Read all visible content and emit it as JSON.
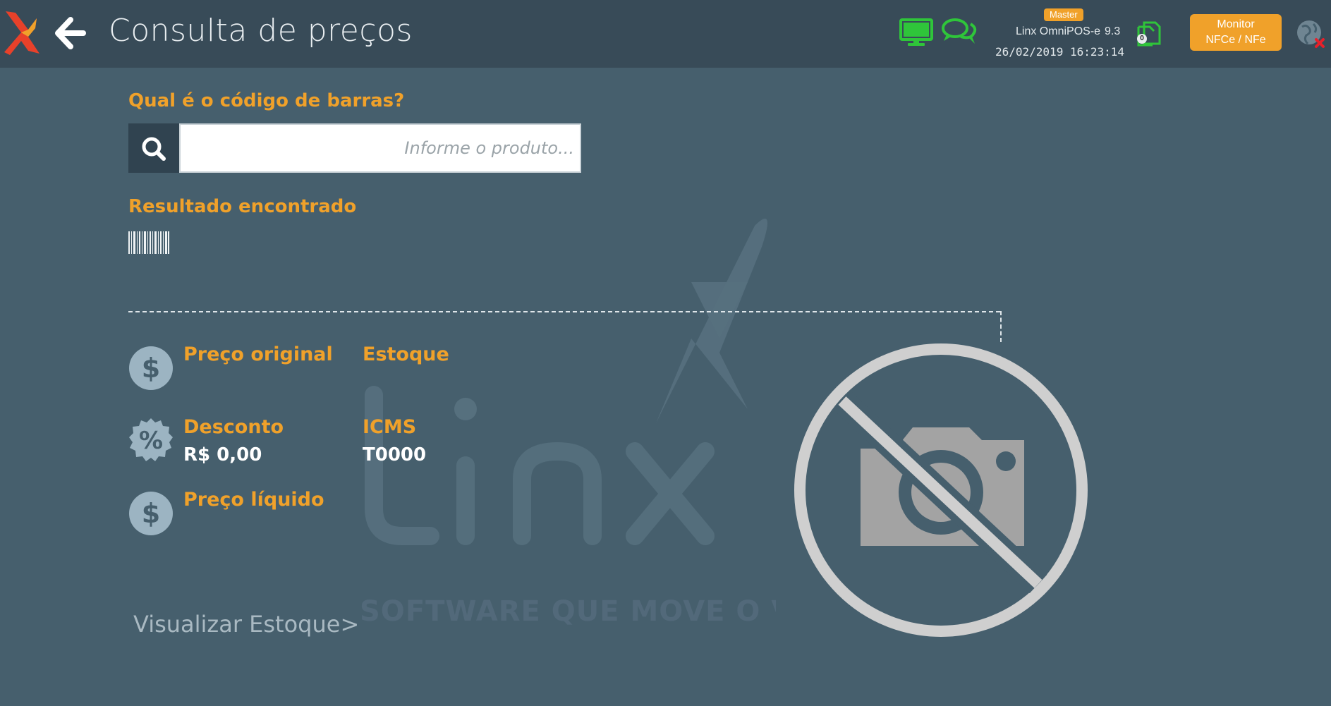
{
  "header": {
    "title": "Consulta de preços",
    "badge": "Master",
    "app_name": "Linx OmniPOS-e",
    "app_version": "9.3",
    "datetime": "26/02/2019 16:23:14",
    "documents_count": "0",
    "monitor_button": {
      "line1": "Monitor",
      "line2": "NFCe / NFe"
    }
  },
  "search": {
    "label": "Qual é o código de barras?",
    "value": "",
    "placeholder": "Informe o produto..."
  },
  "result": {
    "label": "Resultado encontrado"
  },
  "fields": {
    "original_price": {
      "label": "Preço original",
      "value": ""
    },
    "stock": {
      "label": "Estoque",
      "value": ""
    },
    "discount": {
      "label": "Desconto",
      "value": "R$ 0,00"
    },
    "icms": {
      "label": "ICMS",
      "value": "T0000"
    },
    "net_price": {
      "label": "Preço líquido",
      "value": ""
    }
  },
  "links": {
    "view_stock": "Visualizar Estoque>"
  },
  "colors": {
    "background": "#465f6d",
    "topbar": "#384b58",
    "accent": "#f0a12a",
    "status_green": "#2fc53a"
  }
}
